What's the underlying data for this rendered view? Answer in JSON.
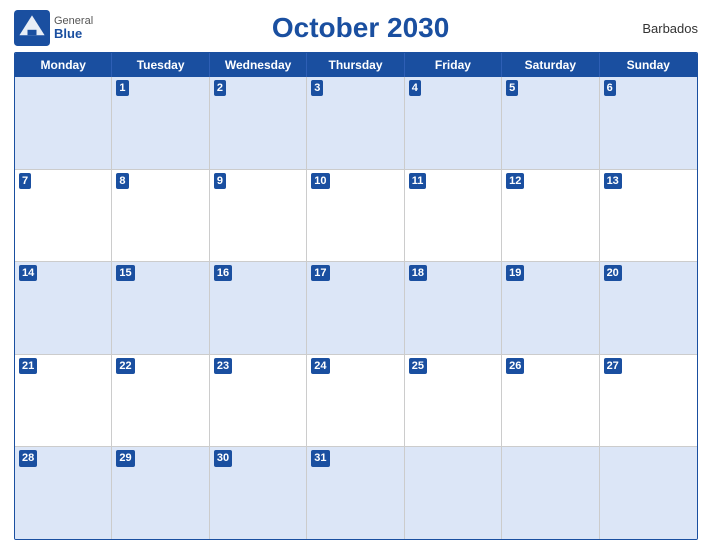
{
  "header": {
    "logo_general": "General",
    "logo_blue": "Blue",
    "title": "October 2030",
    "country": "Barbados"
  },
  "days_of_week": [
    "Monday",
    "Tuesday",
    "Wednesday",
    "Thursday",
    "Friday",
    "Saturday",
    "Sunday"
  ],
  "weeks": [
    [
      {
        "num": "",
        "empty": true
      },
      {
        "num": "1"
      },
      {
        "num": "2"
      },
      {
        "num": "3"
      },
      {
        "num": "4"
      },
      {
        "num": "5"
      },
      {
        "num": "6"
      }
    ],
    [
      {
        "num": "7"
      },
      {
        "num": "8"
      },
      {
        "num": "9"
      },
      {
        "num": "10"
      },
      {
        "num": "11"
      },
      {
        "num": "12"
      },
      {
        "num": "13"
      }
    ],
    [
      {
        "num": "14"
      },
      {
        "num": "15"
      },
      {
        "num": "16"
      },
      {
        "num": "17"
      },
      {
        "num": "18"
      },
      {
        "num": "19"
      },
      {
        "num": "20"
      }
    ],
    [
      {
        "num": "21"
      },
      {
        "num": "22"
      },
      {
        "num": "23"
      },
      {
        "num": "24"
      },
      {
        "num": "25"
      },
      {
        "num": "26"
      },
      {
        "num": "27"
      }
    ],
    [
      {
        "num": "28"
      },
      {
        "num": "29"
      },
      {
        "num": "30"
      },
      {
        "num": "31"
      },
      {
        "num": "",
        "empty": true
      },
      {
        "num": "",
        "empty": true
      },
      {
        "num": "",
        "empty": true
      }
    ]
  ],
  "colors": {
    "blue": "#1a4fa0",
    "row_light": "#fff",
    "row_dark": "#dce6f7"
  }
}
